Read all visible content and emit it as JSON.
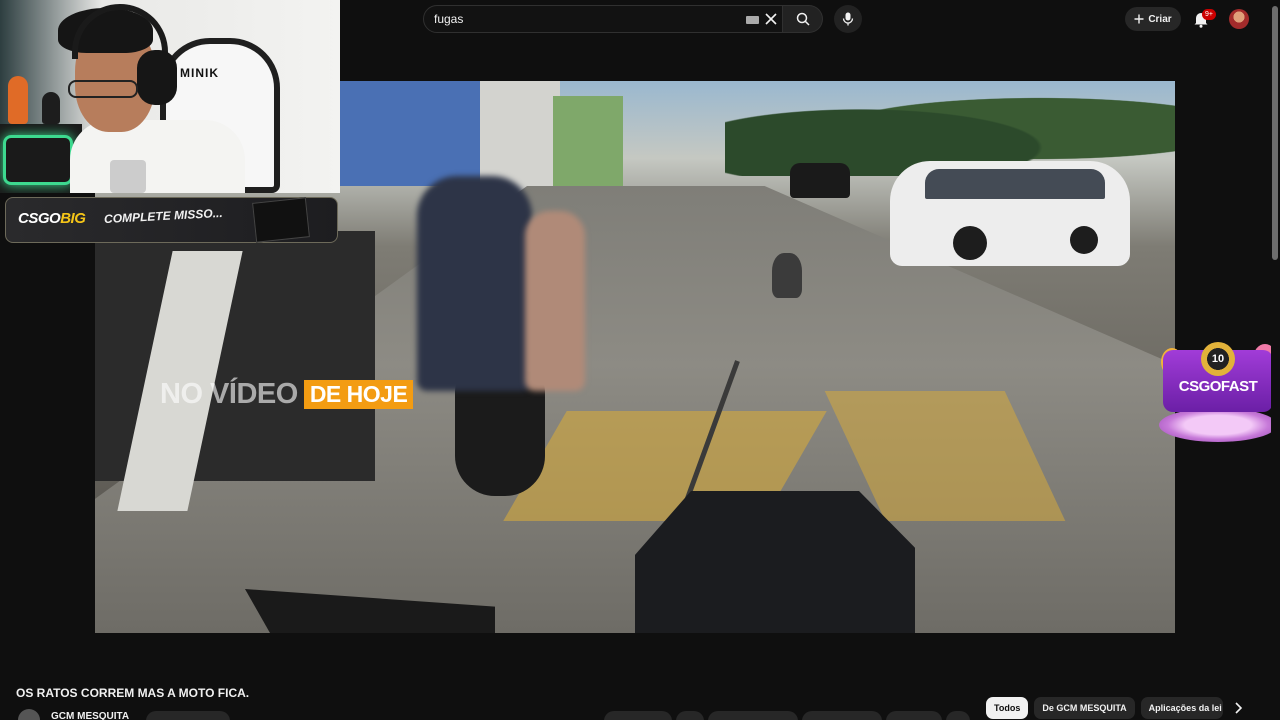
{
  "search": {
    "value": "fugas"
  },
  "header": {
    "create_label": "Criar",
    "notifications_badge": "9+"
  },
  "video": {
    "caption_left": "NO VÍDEO",
    "caption_highlight": "DE HOJE"
  },
  "webcam": {
    "chair_brand": "MINIK"
  },
  "sponsor_banner": {
    "logo_text": "CSGO",
    "logo_accent": "BIG",
    "message": "COMPLETE MISSO..."
  },
  "corner_badge": {
    "coin_label": "10",
    "brand": "CSGOFAST"
  },
  "video_info": {
    "title": "OS RATOS CORREM MAS A MOTO FICA.",
    "channel_name": "GCM MESQUITA"
  },
  "related_chips": [
    {
      "label": "Todos",
      "active": true
    },
    {
      "label": "De GCM MESQUITA",
      "active": false
    },
    {
      "label": "Aplicações da lei",
      "active": false
    }
  ]
}
